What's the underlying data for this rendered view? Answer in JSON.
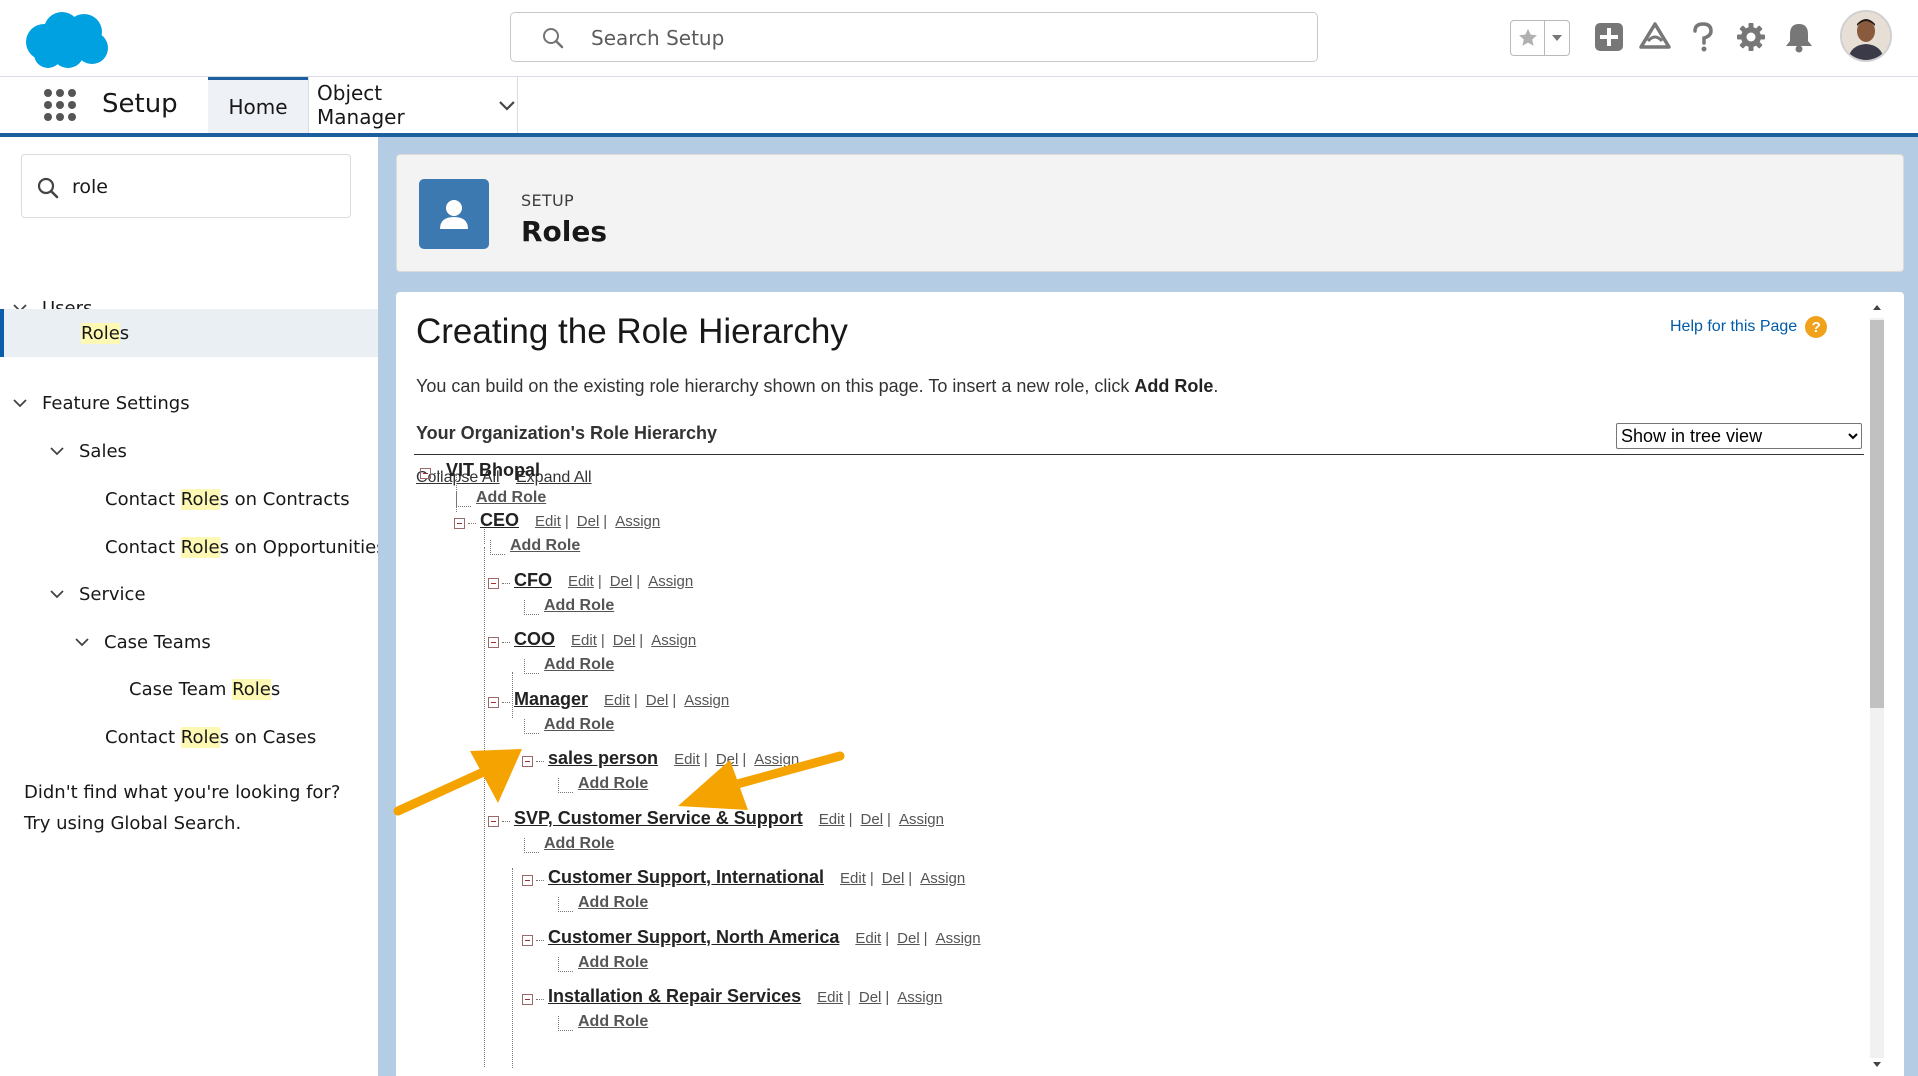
{
  "header": {
    "search_placeholder": "Search Setup",
    "icons": [
      "salesforce-logo",
      "search-icon",
      "favorites-star-icon",
      "favorites-dropdown-icon",
      "global-actions-plus-icon",
      "trailhead-icon",
      "help-icon",
      "gear-icon",
      "notifications-bell-icon",
      "user-avatar"
    ]
  },
  "nav": {
    "app_name": "Setup",
    "tabs": [
      {
        "label": "Home"
      },
      {
        "label": "Object Manager"
      }
    ]
  },
  "sidebar": {
    "quick_find_value": "role",
    "items": [
      {
        "label": "Users"
      },
      {
        "pre": "",
        "hl": "Role",
        "post": "s"
      },
      {
        "label": "Feature Settings"
      },
      {
        "label": "Sales"
      },
      {
        "pre": "Contact ",
        "hl": "Role",
        "post": "s on Contracts"
      },
      {
        "pre": "Contact ",
        "hl": "Role",
        "post": "s on Opportunities"
      },
      {
        "label": "Service"
      },
      {
        "label": "Case Teams"
      },
      {
        "pre": "Case Team ",
        "hl": "Role",
        "post": "s"
      },
      {
        "pre": "Contact ",
        "hl": "Role",
        "post": "s on Cases"
      }
    ],
    "no_results_line1": "Didn't find what you're looking for?",
    "no_results_line2": "Try using Global Search."
  },
  "page_header": {
    "eyebrow": "SETUP",
    "title": "Roles"
  },
  "content": {
    "title": "Creating the Role Hierarchy",
    "help_link": "Help for this Page",
    "help_icon": "?",
    "intro_text": "You can build on the existing role hierarchy shown on this page. To insert a new role, click ",
    "intro_bold": "Add Role",
    "intro_end": ".",
    "section_title": "Your Organization's Role Hierarchy",
    "view_options": [
      "Show in tree view"
    ],
    "collapse_all": "Collapse All",
    "expand_all": "Expand All",
    "add_role_label": "Add Role",
    "edit_label": "Edit",
    "del_label": "Del",
    "assign_label": "Assign",
    "separator": "|",
    "org_name": "VIT Bhopal",
    "roles": [
      {
        "name": "CEO",
        "depth": 1
      },
      {
        "name": "CFO",
        "depth": 2
      },
      {
        "name": "COO",
        "depth": 2
      },
      {
        "name": "Manager",
        "depth": 2
      },
      {
        "name": "sales person",
        "depth": 3
      },
      {
        "name": "SVP, Customer Service & Support",
        "depth": 2
      },
      {
        "name": "Customer Support, International",
        "depth": 3
      },
      {
        "name": "Customer Support, North America",
        "depth": 3
      },
      {
        "name": "Installation & Repair Services",
        "depth": 3
      }
    ]
  },
  "colors": {
    "accent_blue": "#1b5f9e",
    "salesforce_cloud": "#00a1e0",
    "annotation_arrow": "#f5a300",
    "highlight": "#fdf8b3"
  }
}
